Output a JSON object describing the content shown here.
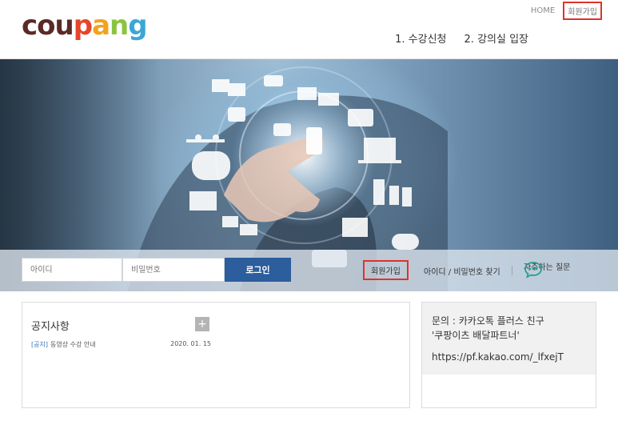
{
  "header": {
    "logo": {
      "letters": [
        "c",
        "o",
        "u",
        "p",
        "a",
        "n",
        "g"
      ],
      "colors": [
        "#5a2a27",
        "#5a2a27",
        "#5a2a27",
        "#e5452b",
        "#f2a31c",
        "#8ac43f",
        "#3aa7d6"
      ]
    },
    "top_links": {
      "home": "HOME",
      "join": "회원가입"
    },
    "nav": {
      "item1": "1. 수강신청",
      "item2": "2. 강의실 입장"
    }
  },
  "login": {
    "id_placeholder": "아이디",
    "pw_placeholder": "비밀번호",
    "login_button": "로그인",
    "join_button": "회원가입",
    "find_link": "아이디 / 비밀번호 찾기",
    "faq_link": "자주하는 질문"
  },
  "notice": {
    "title": "공지사항",
    "more": "+",
    "items": [
      {
        "tag": "[공지]",
        "text": "동영상 수강 안내",
        "date": "2020. 01. 15"
      }
    ]
  },
  "contact": {
    "line1": "문의 : 카카오톡 플러스 친구",
    "line2": "'쿠팡이츠 배달파트너'",
    "link": "https://pf.kakao.com/_lfxejT"
  },
  "colors": {
    "accent": "#2c5d9c",
    "highlight": "#e0322c",
    "tag": "#3b78b8"
  }
}
